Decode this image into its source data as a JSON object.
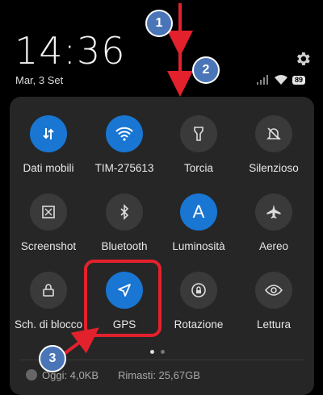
{
  "status": {
    "time": "14:36",
    "date": "Mar, 3 Set",
    "battery": "89"
  },
  "tiles": [
    {
      "label": "Dati mobili",
      "icon": "mobile-data-icon",
      "on": true
    },
    {
      "label": "TIM-275613",
      "icon": "wifi-icon",
      "on": true
    },
    {
      "label": "Torcia",
      "icon": "flashlight-icon",
      "on": false
    },
    {
      "label": "Silenzioso",
      "icon": "bell-off-icon",
      "on": false
    },
    {
      "label": "Screenshot",
      "icon": "screenshot-icon",
      "on": false
    },
    {
      "label": "Bluetooth",
      "icon": "bluetooth-icon",
      "on": false
    },
    {
      "label": "Luminosità",
      "icon": "brightness-auto-icon",
      "on": true
    },
    {
      "label": "Aereo",
      "icon": "airplane-icon",
      "on": false
    },
    {
      "label": "Sch. di blocco",
      "icon": "lock-icon",
      "on": false
    },
    {
      "label": "GPS",
      "icon": "location-arrow-icon",
      "on": true
    },
    {
      "label": "Rotazione",
      "icon": "rotation-lock-icon",
      "on": false
    },
    {
      "label": "Lettura",
      "icon": "eye-icon",
      "on": false
    }
  ],
  "footer": {
    "used": "Oggi: 4,0KB",
    "remaining": "Rimasti: 25,67GB"
  },
  "annotations": {
    "badge1": "1",
    "badge2": "2",
    "badge3": "3",
    "accent": "#e3212d",
    "badge_color": "#4a76b8"
  },
  "colors": {
    "tile_on": "#1976d2",
    "tile_off": "#3a3a3a",
    "panel": "#262626"
  }
}
